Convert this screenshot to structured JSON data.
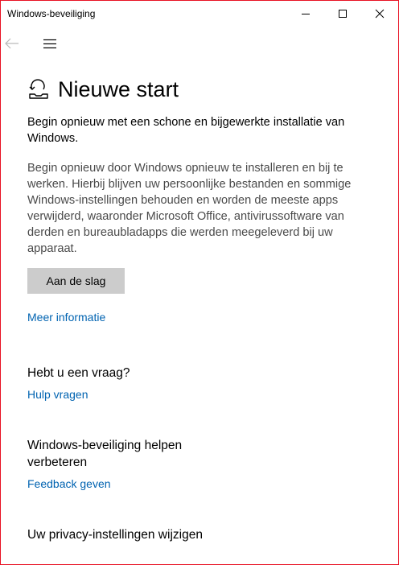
{
  "window": {
    "title": "Windows-beveiliging",
    "border_color": "#e81123"
  },
  "nav": {
    "back_icon": "back-arrow-icon",
    "menu_icon": "hamburger-menu-icon"
  },
  "page": {
    "icon": "fresh-start-icon",
    "title": "Nieuwe start",
    "subtitle": "Begin opnieuw met een schone en bijgewerkte installatie van Windows.",
    "description": "Begin opnieuw door Windows opnieuw te installeren en bij te werken. Hierbij blijven uw persoonlijke bestanden en sommige Windows-instellingen behouden en worden de meeste apps verwijderd, waaronder Microsoft Office, antivirussoftware van derden en bureaubladapps die werden meegeleverd bij uw apparaat.",
    "start_button": "Aan de slag",
    "more_info_link": "Meer informatie"
  },
  "question": {
    "heading": "Hebt u een vraag?",
    "link": "Hulp vragen"
  },
  "improve": {
    "heading": "Windows-beveiliging helpen verbeteren",
    "link": "Feedback geven"
  },
  "privacy": {
    "heading": "Uw privacy-instellingen wijzigen"
  },
  "colors": {
    "link": "#0063b1",
    "button_bg": "#cccccc",
    "description_text": "#4a4a4a"
  }
}
